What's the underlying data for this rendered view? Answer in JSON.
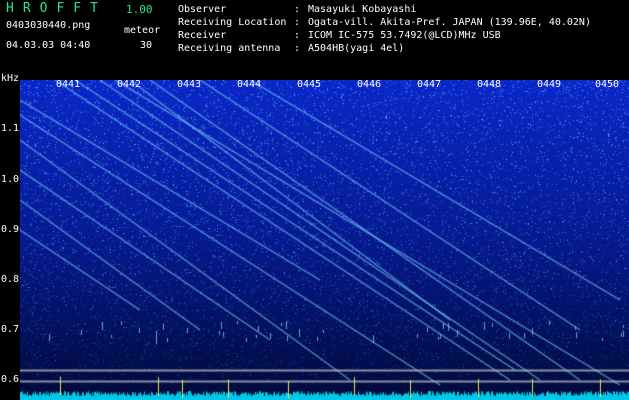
{
  "header": {
    "app_title": "HROFFT",
    "app_version": "1.00",
    "file_name": "0403030440.png",
    "meteor_label": "meteor",
    "timestamp": "04.03.03 04:40",
    "meteor_count": "30",
    "fields": [
      {
        "label": "Observer",
        "value": "Masayuki Kobayashi"
      },
      {
        "label": "Receiving Location",
        "value": "Ogata-vill. Akita-Pref. JAPAN (139.96E, 40.02N)"
      },
      {
        "label": "Receiver",
        "value": "ICOM IC-575 53.7492(@LCD)MHz USB"
      },
      {
        "label": "Receiving antenna",
        "value": "A504HB(yagi 4el)"
      }
    ],
    "separator": ":"
  },
  "spectrogram": {
    "y_unit": "kHz",
    "y_ticks": [
      "1.1",
      "1.0",
      "0.9",
      "0.8",
      "0.7",
      "0.6"
    ],
    "time_ticks": [
      "0441",
      "0442",
      "0443",
      "0444",
      "0445",
      "0446",
      "0447",
      "0448",
      "0449",
      "0450"
    ],
    "colors": {
      "background": "#00106a",
      "noise": "#2250ff",
      "trace": "#7ad8ff",
      "floor": "#00c8e8",
      "ref_line": "#c8c8c8"
    }
  }
}
